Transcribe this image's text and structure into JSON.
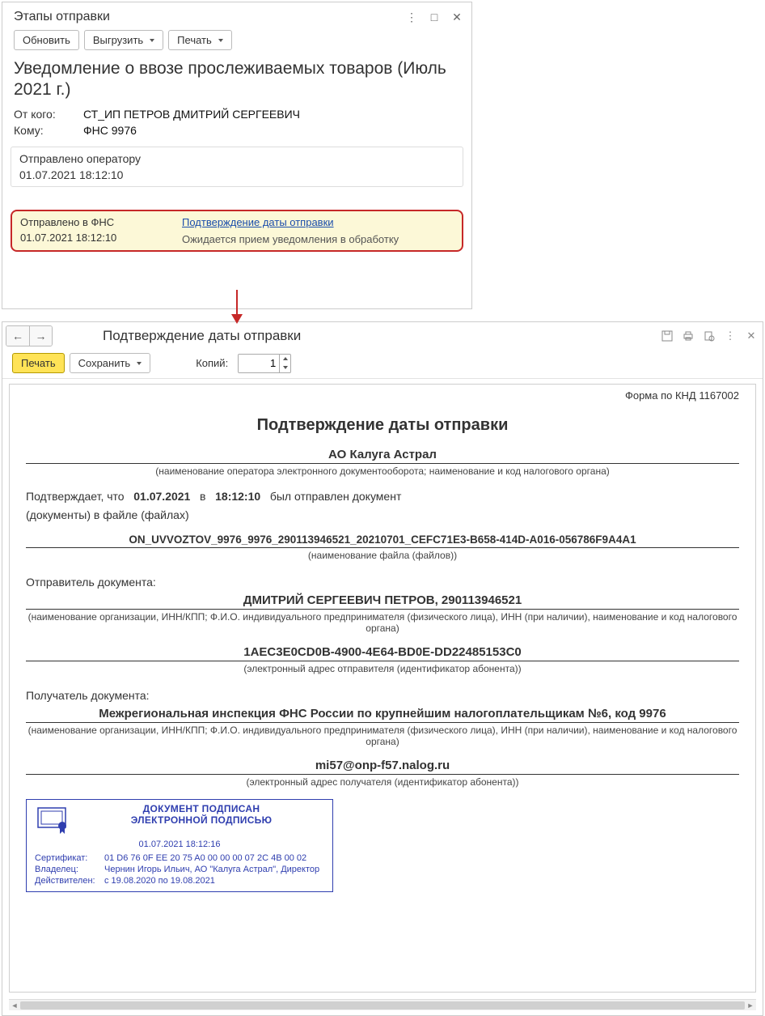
{
  "win1": {
    "title": "Этапы отправки",
    "icons": {
      "more": "⋮",
      "max": "□",
      "close": "✕"
    },
    "toolbar": {
      "refresh": "Обновить",
      "export": "Выгрузить",
      "print": "Печать"
    },
    "doc_title": "Уведомление о ввозе прослеживаемых товаров (Июль 2021 г.)",
    "from_label": "От кого:",
    "from_value": "СТ_ИП ПЕТРОВ ДМИТРИЙ СЕРГЕЕВИЧ",
    "to_label": "Кому:",
    "to_value": "ФНС 9976",
    "stage1": {
      "title": "Отправлено оператору",
      "ts": "01.07.2021 18:12:10"
    },
    "stage2": {
      "title": "Отправлено в ФНС",
      "ts": "01.07.2021 18:12:10",
      "link": "Подтверждение даты отправки",
      "sub": "Ожидается прием уведомления в обработку"
    }
  },
  "win2": {
    "title": "Подтверждение даты отправки",
    "nav": {
      "back": "←",
      "fwd": "→"
    },
    "tb_right": {
      "save": "save",
      "print": "print",
      "preview": "preview",
      "more": "⋮",
      "close": "✕"
    },
    "toolbar": {
      "print": "Печать",
      "save": "Сохранить",
      "copies_label": "Копий:",
      "copies_value": "1"
    }
  },
  "doc": {
    "form_code": "Форма по КНД 1167002",
    "h1": "Подтверждение даты отправки",
    "operator": "АО Калуга Астрал",
    "operator_sub": "(наименование оператора электронного документооборота; наименование и код налогового органа)",
    "confirm_pre": "Подтверждает, что",
    "date": "01.07.2021",
    "v": "в",
    "time": "18:12:10",
    "confirm_post": "был отправлен документ",
    "para2": "(документы) в файле (файлах)",
    "filename": "ON_UVVOZTOV_9976_9976_290113946521_20210701_CEFC71E3-B658-414D-A016-056786F9A4A1",
    "filename_sub": "(наименование файла (файлов))",
    "sender_lbl": "Отправитель документа:",
    "sender": "ДМИТРИЙ СЕРГЕЕВИЧ ПЕТРОВ, 290113946521",
    "sender_sub": "(наименование организации, ИНН/КПП; Ф.И.О. индивидуального предпринимателя (физического лица), ИНН (при наличии), наименование и код налогового органа)",
    "sender_id": "1AEC3E0CD0B-4900-4E64-BD0E-DD22485153C0",
    "sender_id_sub": "(электронный адрес отправителя (идентификатор абонента))",
    "recip_lbl": "Получатель документа:",
    "recip": "Межрегиональная инспекция ФНС России по крупнейшим налогоплательщикам №6, код 9976",
    "recip_sub": "(наименование организации, ИНН/КПП; Ф.И.О. индивидуального предпринимателя (физического лица), ИНН (при наличии), наименование и код налогового органа)",
    "recip_email": "mi57@onp-f57.nalog.ru",
    "recip_email_sub": "(электронный адрес получателя (идентификатор абонента))"
  },
  "sig": {
    "title1": "ДОКУМЕНТ ПОДПИСАН",
    "title2": "ЭЛЕКТРОННОЙ ПОДПИСЬЮ",
    "date": "01.07.2021 18:12:16",
    "cert_k": "Сертификат:",
    "cert_v": "01 D6 76 0F EE 20 75 A0 00 00 00 07 2C 4B 00 02",
    "owner_k": "Владелец:",
    "owner_v": "Чернин Игорь Ильич, АО \"Калуга Астрал\", Директор",
    "valid_k": "Действителен:",
    "valid_v": "с 19.08.2020 по 19.08.2021"
  }
}
